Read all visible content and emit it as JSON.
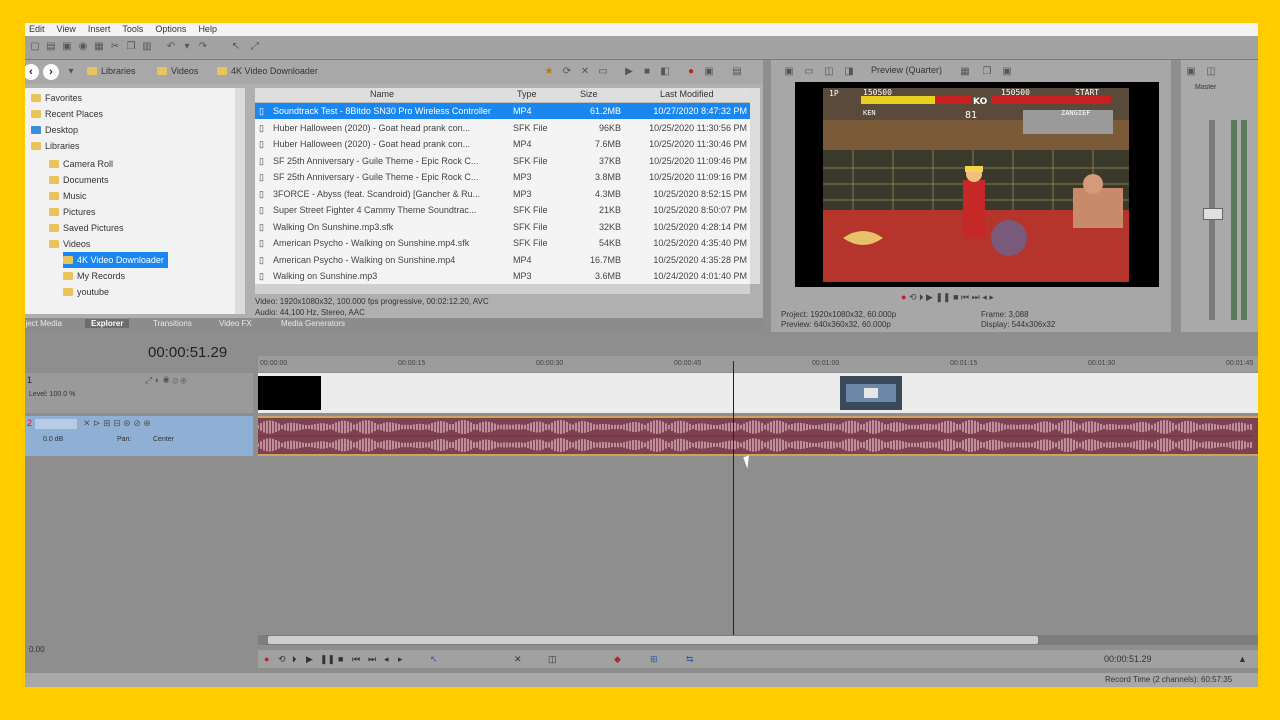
{
  "menu": [
    "Edit",
    "View",
    "Insert",
    "Tools",
    "Options",
    "Help"
  ],
  "explorer": {
    "breadcrumb": [
      "Libraries",
      "Videos",
      "4K Video Downloader"
    ],
    "tree": [
      {
        "label": "Favorites"
      },
      {
        "label": "Recent Places"
      },
      {
        "label": "Desktop"
      },
      {
        "label": "Libraries"
      },
      {
        "label": "Camera Roll"
      },
      {
        "label": "Documents"
      },
      {
        "label": "Music"
      },
      {
        "label": "Pictures"
      },
      {
        "label": "Saved Pictures"
      },
      {
        "label": "Videos"
      },
      {
        "label": "4K Video Downloader",
        "selected": true
      },
      {
        "label": "My Records"
      },
      {
        "label": "youtube"
      }
    ],
    "columns": {
      "name": "Name",
      "type": "Type",
      "size": "Size",
      "modified": "Last Modified"
    },
    "files": [
      {
        "name": "Soundtrack Test - 8Bitdo SN30 Pro Wireless Controller",
        "type": "MP4",
        "size": "61.2MB",
        "modified": "10/27/2020 8:47:32 PM",
        "selected": true
      },
      {
        "name": "Huber Halloween (2020) - Goat head prank con...",
        "type": "SFK File",
        "size": "96KB",
        "modified": "10/25/2020 11:30:56 PM"
      },
      {
        "name": "Huber Halloween (2020) - Goat head prank con...",
        "type": "MP4",
        "size": "7.6MB",
        "modified": "10/25/2020 11:30:46 PM"
      },
      {
        "name": "SF 25th Anniversary - Guile Theme - Epic Rock C...",
        "type": "SFK File",
        "size": "37KB",
        "modified": "10/25/2020 11:09:46 PM"
      },
      {
        "name": "SF 25th Anniversary - Guile Theme - Epic Rock C...",
        "type": "MP3",
        "size": "3.8MB",
        "modified": "10/25/2020 11:09:16 PM"
      },
      {
        "name": "3FORCE - Abyss (feat. Scandroid) [Gancher & Ru...",
        "type": "MP3",
        "size": "4.3MB",
        "modified": "10/25/2020 8:52:15 PM"
      },
      {
        "name": "Super Street Fighter 4 Cammy Theme Soundtrac...",
        "type": "SFK File",
        "size": "21KB",
        "modified": "10/25/2020 8:50:07 PM"
      },
      {
        "name": "Walking On Sunshine.mp3.sfk",
        "type": "SFK File",
        "size": "32KB",
        "modified": "10/25/2020 4:28:14 PM"
      },
      {
        "name": "American Psycho - Walking on Sunshine.mp4.sfk",
        "type": "SFK File",
        "size": "54KB",
        "modified": "10/25/2020 4:35:40 PM"
      },
      {
        "name": "American Psycho - Walking on Sunshine.mp4",
        "type": "MP4",
        "size": "16.7MB",
        "modified": "10/25/2020 4:35:28 PM"
      },
      {
        "name": "Walking on Sunshine.mp3",
        "type": "MP3",
        "size": "3.6MB",
        "modified": "10/24/2020 4:01:40 PM"
      }
    ],
    "info_video": "Video: 1920x1080x32, 100.000 fps progressive, 00:02:12.20, AVC",
    "info_audio": "Audio: 44,100 Hz, Stereo, AAC",
    "tabs": [
      "Project Media",
      "Explorer",
      "Transitions",
      "Video FX",
      "Media Generators"
    ]
  },
  "preview": {
    "mode": "Preview (Quarter)",
    "project": "Project: 1920x1080x32, 60.000p",
    "preview_res": "Preview: 640x360x32, 60.000p",
    "frame": "Frame: 3,088",
    "display": "Display: 544x306x32",
    "hud": {
      "p1": "1P",
      "score1": "150500",
      "hi": "150500",
      "start": "START",
      "ko": "KO",
      "name1": "KEN",
      "name2": "ZANGIEF",
      "timer": "81"
    }
  },
  "mixer": {
    "label": "Master"
  },
  "timeline": {
    "timecode": "00:00:51.29",
    "ruler": [
      "00:00:00",
      "00:00:15",
      "00:00:30",
      "00:00:45",
      "00:01:00",
      "00:01:15",
      "00:01:30",
      "00:01:45"
    ],
    "video_level": "Level: 100.0 %",
    "audio_vol": "0.0 dB",
    "audio_pan": "Pan:",
    "audio_center": "Center"
  },
  "transport": {
    "time": "00:00:51.29"
  },
  "status": {
    "rate": "0.00",
    "record_time": "Record Time (2 channels): 60:57:35"
  }
}
